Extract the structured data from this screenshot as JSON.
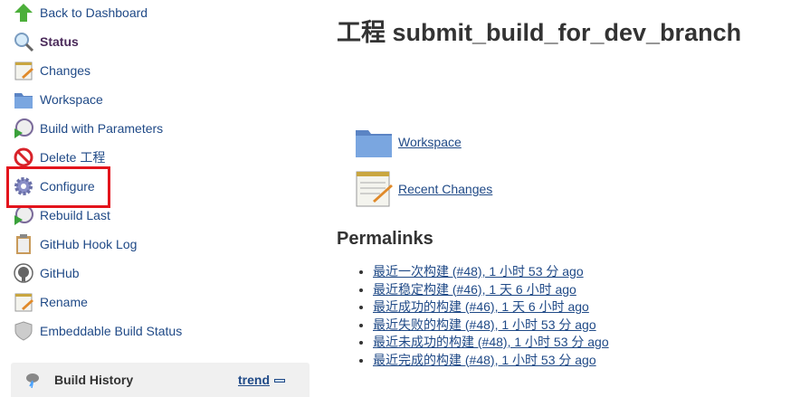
{
  "sidebar": {
    "items": [
      {
        "label": "Back to Dashboard",
        "icon": "up-arrow-icon"
      },
      {
        "label": "Status",
        "icon": "search-icon"
      },
      {
        "label": "Changes",
        "icon": "notepad-icon"
      },
      {
        "label": "Workspace",
        "icon": "folder-icon"
      },
      {
        "label": "Build with Parameters",
        "icon": "clock-play-icon"
      },
      {
        "label": "Delete 工程",
        "icon": "no-entry-icon"
      },
      {
        "label": "Configure",
        "icon": "gear-icon"
      },
      {
        "label": "Rebuild Last",
        "icon": "clock-play-icon"
      },
      {
        "label": "GitHub Hook Log",
        "icon": "clipboard-icon"
      },
      {
        "label": "GitHub",
        "icon": "github-icon"
      },
      {
        "label": "Rename",
        "icon": "notepad-icon"
      },
      {
        "label": "Embeddable Build Status",
        "icon": "shield-icon"
      }
    ],
    "highlight_color": "#e3141c",
    "build_history": {
      "title": "Build History",
      "trend": "trend"
    }
  },
  "main": {
    "title": "工程 submit_build_for_dev_branch",
    "links": [
      {
        "label": "Workspace",
        "icon": "folder-icon"
      },
      {
        "label": "Recent Changes",
        "icon": "notepad-icon"
      }
    ],
    "permalinks_title": "Permalinks",
    "permalinks": [
      "最近一次构建 (#48), 1 小时 53 分 ago",
      "最近稳定构建 (#46), 1 天 6 小时 ago",
      "最近成功的构建 (#46), 1 天 6 小时 ago",
      "最近失败的构建 (#48), 1 小时 53 分 ago",
      "最近未成功的构建 (#48), 1 小时 53 分 ago",
      "最近完成的构建 (#48), 1 小时 53 分 ago"
    ]
  },
  "colors": {
    "link": "#204a87"
  }
}
